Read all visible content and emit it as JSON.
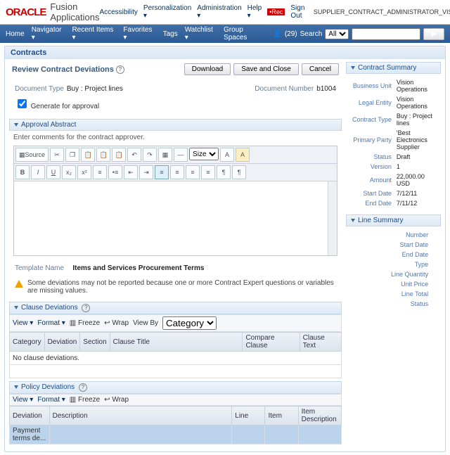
{
  "brand": {
    "oracle": "ORACLE",
    "fusion": "Fusion Applications"
  },
  "top": {
    "accessibility": "Accessibility",
    "personalization": "Personalization",
    "administration": "Administration",
    "help": "Help",
    "signout": "Sign Out",
    "role": "SUPPLIER_CONTRACT_ADMINISTRATOR_VISION_OPERATIONS"
  },
  "nav": {
    "home": "Home",
    "navigator": "Navigator",
    "recent": "Recent Items",
    "favorites": "Favorites",
    "tags": "Tags",
    "watchlist": "Watchlist",
    "spaces": "Group Spaces",
    "userCount": "(29)",
    "searchLabel": "Search",
    "searchScope": "All"
  },
  "crumb": "Contracts",
  "page": {
    "title": "Review Contract Deviations"
  },
  "buttons": {
    "download": "Download",
    "save": "Save and Close",
    "cancel": "Cancel"
  },
  "meta": {
    "docTypeLabel": "Document Type",
    "docType": "Buy : Project lines",
    "docNumLabel": "Document Number",
    "docNum": "b1004"
  },
  "gen": {
    "label": "Generate for approval"
  },
  "abstract": {
    "title": "Approval Abstract",
    "hint": "Enter comments for the contract approver."
  },
  "editor": {
    "sourceBtn": "Source",
    "sizeLabel": "Size"
  },
  "template": {
    "label": "Template Name",
    "value": "Items and Services Procurement Terms"
  },
  "warning": "Some deviations may not be reported because one or more Contract Expert questions or variables are missing values.",
  "clauseDev": {
    "title": "Clause Deviations",
    "view": "View",
    "format": "Format",
    "freeze": "Freeze",
    "wrap": "Wrap",
    "viewBy": "View By",
    "viewByValue": "Category",
    "cols": {
      "category": "Category",
      "deviation": "Deviation",
      "section": "Section",
      "clauseTitle": "Clause Title",
      "compare": "Compare Clause",
      "clauseText": "Clause Text"
    },
    "empty": "No clause deviations."
  },
  "policyDev": {
    "title": "Policy Deviations",
    "view": "View",
    "format": "Format",
    "freeze": "Freeze",
    "wrap": "Wrap",
    "cols": {
      "deviation": "Deviation",
      "description": "Description",
      "line": "Line",
      "item": "Item",
      "itemDesc": "Item Description"
    },
    "row1": "Payment terms de..."
  },
  "summary": {
    "title": "Contract Summary",
    "rows": [
      [
        "Business Unit",
        "Vision Operations"
      ],
      [
        "Legal Entity",
        "Vision Operations"
      ],
      [
        "Contract Type",
        "Buy : Project lines"
      ],
      [
        "Primary Party",
        "'Best Electronics Supplier"
      ],
      [
        "Status",
        "Draft"
      ],
      [
        "Version",
        "1"
      ],
      [
        "Amount",
        "22,000.00  USD"
      ],
      [
        "Start Date",
        "7/12/11"
      ],
      [
        "End Date",
        "7/11/12"
      ]
    ]
  },
  "lineSummary": {
    "title": "Line Summary",
    "rows": [
      "Number",
      "Start Date",
      "End Date",
      "Type",
      "Line Quantity",
      "Unit Price",
      "Line Total",
      "Status"
    ]
  }
}
